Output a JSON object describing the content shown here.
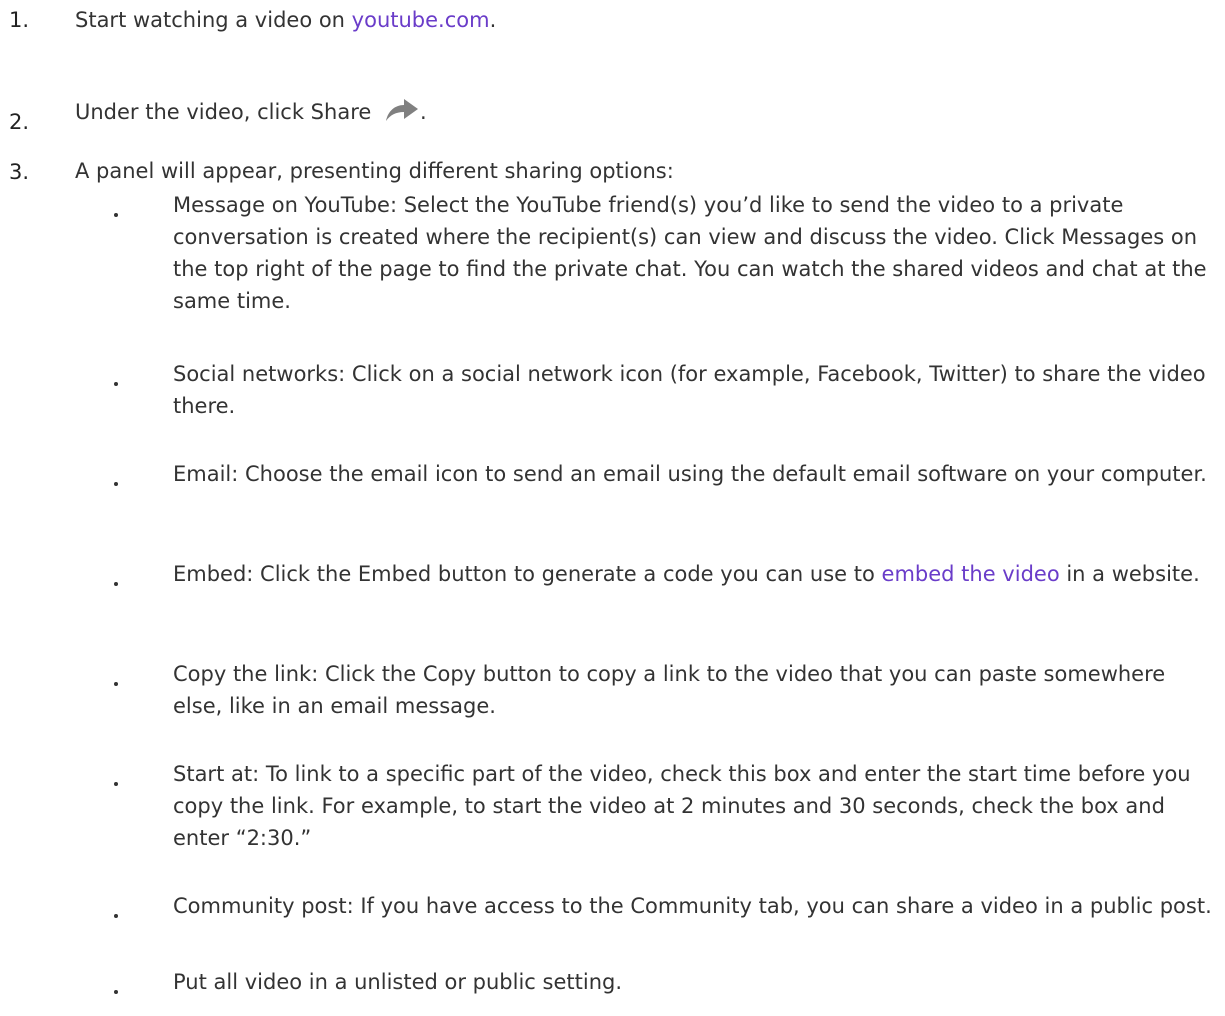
{
  "steps": [
    {
      "num": "1.",
      "text_before": "Start watching a video on ",
      "link": "youtube.com",
      "text_after": "."
    },
    {
      "num": "2.",
      "text_before": "Under the video, click Share",
      "icon": "share-arrow-icon",
      "text_after": "."
    },
    {
      "num": "3.",
      "text": "A panel will appear, presenting different sharing options:"
    }
  ],
  "bullets": [
    {
      "text": "Message on YouTube: Select the YouTube friend(s) you’d like to send the video to a private conversation is created where the recipient(s) can view and discuss the video. Click Messages on the top right of the page to find the private chat. You can watch the shared videos and chat at the same time."
    },
    {
      "text": "Social networks: Click on a social network icon (for example, Facebook, Twitter) to share the video there."
    },
    {
      "text": "Email: Choose the email icon to send an email using the default email software on your computer."
    },
    {
      "text_before": "Embed: Click the Embed button to generate a code you can use to ",
      "link": "embed the video",
      "text_after": " in a website."
    },
    {
      "text": "Copy the link: Click the Copy button to copy a link to the video that you can paste somewhere else, like in an email message."
    },
    {
      "text": "Start at: To link to a specific part of the video, check this box and enter the start time before you copy the link. For example, to start the video at 2 minutes and 30 seconds, check the box and enter “2:30.”"
    },
    {
      "text": "Community post: If you have access to the Community tab, you can share a video in a public post."
    },
    {
      "text": "Put all video in a unlisted or public setting."
    }
  ],
  "colors": {
    "link": "#6a3cc9",
    "text": "#333333"
  }
}
